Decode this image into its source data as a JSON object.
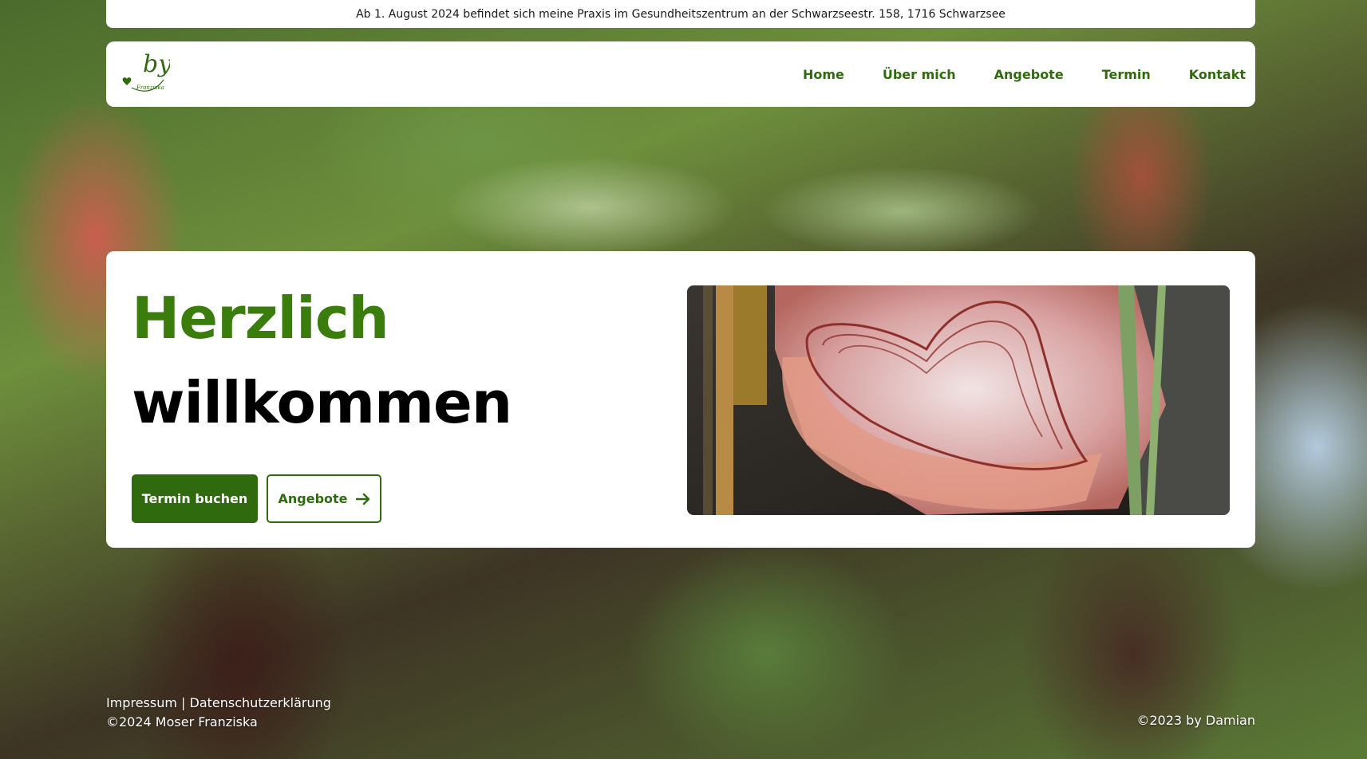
{
  "notice": {
    "text": "Ab 1. August 2024 befindet sich meine Praxis im Gesundheitszentrum an der Schwarzseestr. 158, 1716 Schwarzsee"
  },
  "logo": {
    "wordmark": "by",
    "subtext": "Franziska"
  },
  "nav": {
    "items": [
      {
        "label": "Home"
      },
      {
        "label": "Über mich"
      },
      {
        "label": "Angebote"
      },
      {
        "label": "Termin"
      },
      {
        "label": "Kontakt"
      }
    ]
  },
  "hero": {
    "heading_line1": "Herzlich",
    "heading_line2": "willkommen",
    "primary_button": "Termin buchen",
    "secondary_button": "Angebote"
  },
  "footer": {
    "impressum": "Impressum",
    "separator": "|",
    "privacy": "Datenschutzerklärung",
    "copyright": "©2024 Moser Franziska",
    "credit": "©2023 by Damian"
  },
  "colors": {
    "brand_green": "#2f6b0e",
    "heading_green": "#3a7d0c"
  },
  "icons": {
    "heart": "heart-icon",
    "arrow": "arrow-right-icon"
  }
}
